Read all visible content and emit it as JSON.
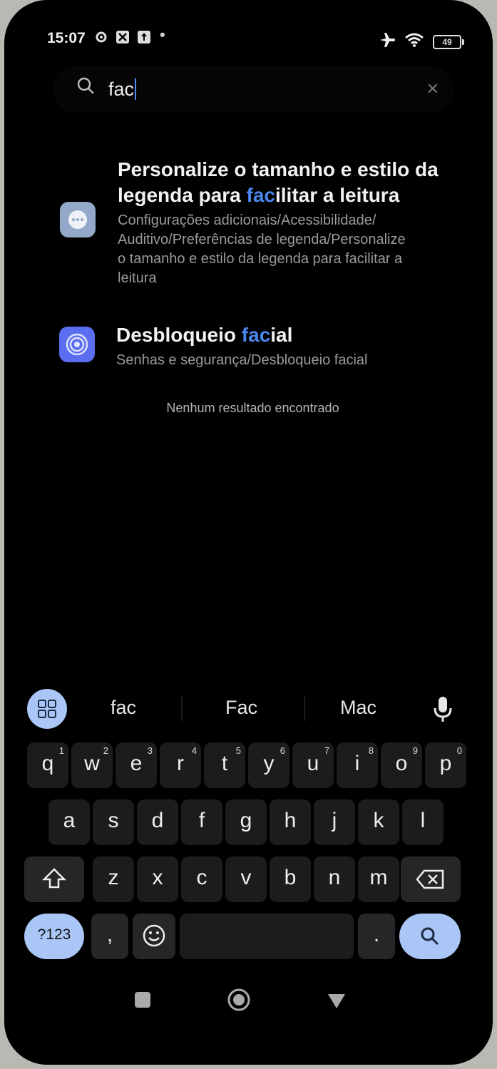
{
  "status_bar": {
    "time": "15:07",
    "battery": "49",
    "icons": [
      "gear-icon",
      "x-box-icon",
      "upload-box-icon",
      "dot-icon",
      "airplane-icon",
      "wifi-icon",
      "battery-icon"
    ]
  },
  "search": {
    "query": "fac",
    "clear_icon": "close-icon"
  },
  "results": [
    {
      "title_pre": "Personalize o tamanho e estilo da legenda para ",
      "title_hl": "fac",
      "title_post": "ilitar a leitura",
      "path_lines": [
        "Configurações adicionais/Acessibilidade/",
        "Auditivo/Preferências de legenda/Personalize",
        "o tamanho e estilo da legenda para facilitar a",
        "leitura"
      ],
      "icon": "more-dots-icon",
      "icon_color": "#94a9c9"
    },
    {
      "title_pre": "Desbloqueio ",
      "title_hl": "fac",
      "title_post": "ial",
      "path_lines": [
        "Senhas e segurança/Desbloqueio facial"
      ],
      "icon": "face-unlock-icon",
      "icon_color": "#5b6ef2"
    }
  ],
  "no_results": "Nenhum resultado encontrado",
  "keyboard": {
    "suggestions": [
      "fac",
      "Fac",
      "Mac"
    ],
    "row1": [
      {
        "k": "q",
        "n": "1"
      },
      {
        "k": "w",
        "n": "2"
      },
      {
        "k": "e",
        "n": "3"
      },
      {
        "k": "r",
        "n": "4"
      },
      {
        "k": "t",
        "n": "5"
      },
      {
        "k": "y",
        "n": "6"
      },
      {
        "k": "u",
        "n": "7"
      },
      {
        "k": "i",
        "n": "8"
      },
      {
        "k": "o",
        "n": "9"
      },
      {
        "k": "p",
        "n": "0"
      }
    ],
    "row2": [
      "a",
      "s",
      "d",
      "f",
      "g",
      "h",
      "j",
      "k",
      "l"
    ],
    "row3": [
      "z",
      "x",
      "c",
      "v",
      "b",
      "n",
      "m"
    ],
    "symbols_key": "?123",
    "comma_key": ",",
    "period_key": "."
  },
  "colors": {
    "highlight": "#4c86ef",
    "accent_key": "#a9c6f6"
  }
}
